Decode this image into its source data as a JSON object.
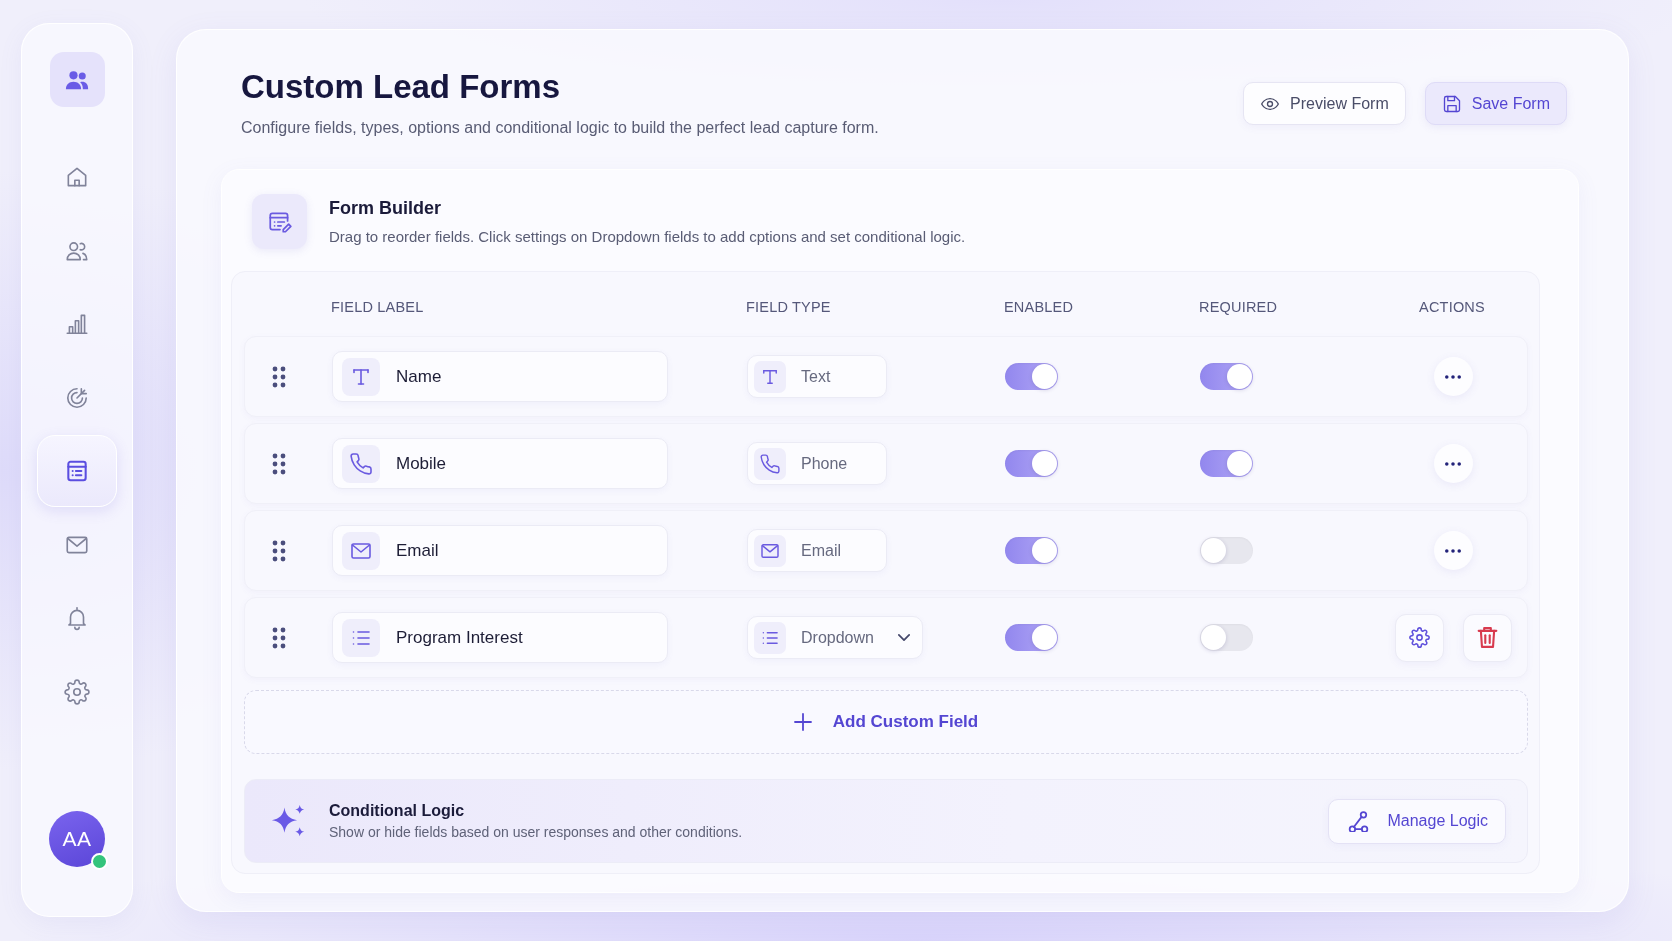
{
  "sidebar": {
    "items": [
      {
        "selected": false
      },
      {
        "selected": false
      },
      {
        "selected": false
      },
      {
        "selected": false
      },
      {
        "selected": true
      },
      {
        "selected": false
      },
      {
        "selected": false
      },
      {
        "selected": false
      }
    ],
    "avatar": {
      "initials": "AA",
      "online": true
    }
  },
  "header": {
    "title": "Custom Lead Forms",
    "subtitle": "Configure fields, types, options and conditional logic to build the perfect lead capture form.",
    "buttons": [
      {
        "label": "Preview Form",
        "kind": "preview"
      },
      {
        "label": "Save Form",
        "kind": "save"
      }
    ]
  },
  "form_builder": {
    "title": "Form Builder",
    "description": "Drag to reorder fields. Click settings on Dropdown fields to add cptions and set conditional logic.",
    "table": {
      "columns": [
        "FIELD LABEL",
        "FIELD TYPE",
        "ENABLED",
        "REQUIRED",
        "ACTIONS"
      ],
      "rows": [
        {
          "label": "Name",
          "type": "Text",
          "kind": "text",
          "enabled": true,
          "required": true,
          "actions": [
            {
              "kind": "more"
            }
          ]
        },
        {
          "label": "Mobile",
          "type": "Phone",
          "kind": "phone",
          "enabled": true,
          "required": true,
          "actions": [
            {
              "kind": "more"
            }
          ]
        },
        {
          "label": "Email",
          "type": "Email",
          "kind": "email",
          "enabled": true,
          "required": false,
          "actions": [
            {
              "kind": "more"
            }
          ]
        },
        {
          "label": "Program Interest",
          "type": "Dropdown",
          "kind": "dropdown",
          "enabled": true,
          "required": false,
          "actions": [
            {
              "kind": "settings"
            },
            {
              "kind": "delete"
            }
          ]
        }
      ]
    },
    "add_field": {
      "label": "Add Custom Field"
    },
    "conditional_logic": {
      "title": "Conditional Logic",
      "description": "Show or hide fields based on user responses and other conditions.",
      "button": "Manage Logic"
    }
  }
}
